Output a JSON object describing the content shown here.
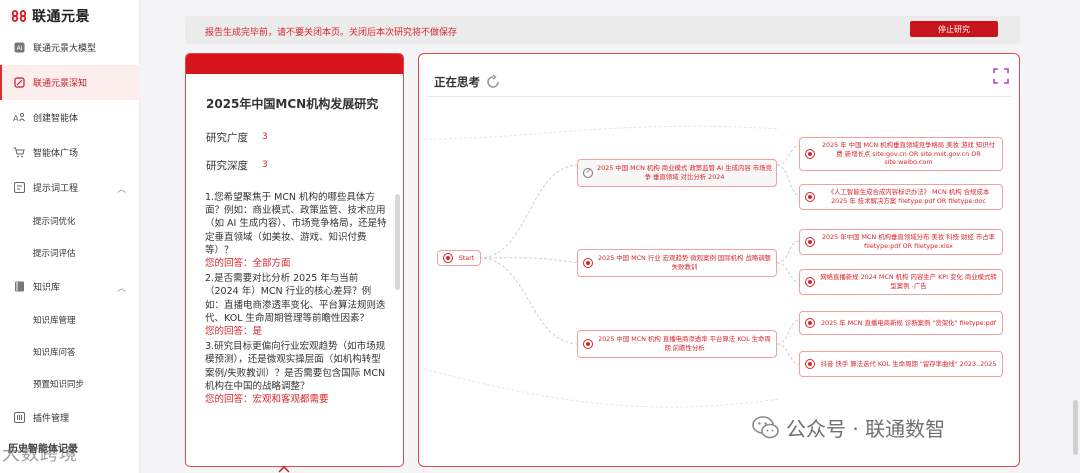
{
  "app": {
    "logo_text": "联通元景"
  },
  "sidebar": {
    "items": [
      {
        "label": "联通元景大模型",
        "icon": "ai-chip-icon"
      },
      {
        "label": "联通元景深知",
        "icon": "tablet-icon",
        "active": true
      },
      {
        "label": "创建智能体",
        "icon": "agent-icon"
      },
      {
        "label": "智能体广场",
        "icon": "cart-icon"
      },
      {
        "label": "提示词工程",
        "icon": "prompt-icon",
        "expandable": true
      },
      {
        "label": "提示词优化",
        "sub": true
      },
      {
        "label": "提示词评估",
        "sub": true
      },
      {
        "label": "知识库",
        "icon": "book-icon",
        "expandable": true
      },
      {
        "label": "知识库管理",
        "sub": true
      },
      {
        "label": "知识库问答",
        "sub": true
      },
      {
        "label": "预置知识同步",
        "sub": true
      },
      {
        "label": "插件管理",
        "icon": "plugin-icon"
      }
    ],
    "footer": "历史智能体记录"
  },
  "banner": {
    "text": "报告生成完毕前，请不要关闭本页。关闭后本次研究将不做保存",
    "stop_label": "停止研究"
  },
  "research": {
    "title": "2025年中国MCN机构发展研究",
    "breadth_label": "研究广度",
    "breadth_value": "3",
    "depth_label": "研究深度",
    "depth_value": "3",
    "qa": [
      {
        "q": "1.您希望聚焦于 MCN 机构的哪些具体方面？例如：商业模式、政策监管、技术应用（如 AI 生成内容）、市场竞争格局，还是特定垂直领域（如美妆、游戏、知识付费等）？",
        "a": "您的回答：全部方面"
      },
      {
        "q": "2.是否需要对比分析 2025 年与当前（2024 年）MCN 行业的核心差异？例如：直播电商渗透率变化、平台算法规则迭代、KOL 生命周期管理等前瞻性因素？",
        "a": "您的回答：是"
      },
      {
        "q": "3.研究目标更偏向行业宏观趋势（如市场规模预测），还是微观实操层面（如机构转型案例/失败教训）？是否需要包含国际 MCN 机构在中国的战略调整？",
        "a": "您的回答：宏观和客观都需要"
      }
    ]
  },
  "thinking": {
    "title": "正在思考",
    "root": "Start",
    "branches": [
      {
        "label": "2025 中国 MCN 机构 商业模式 政策监管 AI 生成内容 市场竞争 垂直领域 对比分析 2024",
        "leaves": [
          "2025 年 中国 MCN 机构垂直领域竞争格局 美妆 游戏 知识付费 新增长点 site:gov.cn OR site:miit.gov.cn OR site:weibo.com",
          "《人工智能生成合成内容标识办法》 MCN 机构 合规成本 2025 年 技术解决方案 filetype:pdf OR filetype:doc"
        ]
      },
      {
        "label": "2025 中国 MCN 行业 宏观趋势 微观案例 国际机构 战略调整 失败教训",
        "leaves": [
          "2025 年中国 MCN 机构垂直领域分布 美妆 科技 财经 市占率 filetype:pdf OR filetype:xlsx",
          "网络直播新规 2024 MCN 机构 内容生产 KPI 变化 商业模式转型案例 -广告"
        ]
      },
      {
        "label": "2025 中国 MCN 机构 直播电商渗透率 平台算法 KOL 生命周期 前瞻性分析",
        "leaves": [
          "2025 年 MCN 直播电商新规 诊断案例 \"货架化\" filetype:pdf",
          "抖音 快手 算法迭代 KOL 生命周期 \"留存率曲线\" 2023..2025"
        ]
      }
    ]
  },
  "watermarks": {
    "wechat": "公众号 · 联通数智",
    "left": "大数跨境"
  },
  "colors": {
    "accent": "#d8141c",
    "accent_text": "#d8262a",
    "active_bg": "#fdeeee"
  }
}
